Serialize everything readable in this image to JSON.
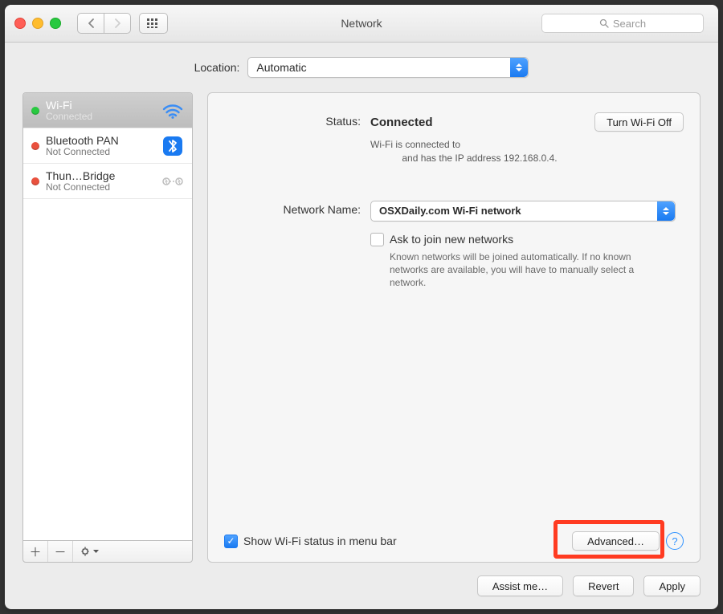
{
  "window": {
    "title": "Network",
    "search_placeholder": "Search"
  },
  "location": {
    "label": "Location:",
    "value": "Automatic"
  },
  "services": [
    {
      "name": "Wi-Fi",
      "status": "Connected",
      "dot": "green",
      "icon": "wifi",
      "selected": true
    },
    {
      "name": "Bluetooth PAN",
      "status": "Not Connected",
      "dot": "red",
      "icon": "bluetooth",
      "selected": false
    },
    {
      "name": "Thun…Bridge",
      "status": "Not Connected",
      "dot": "red",
      "icon": "thunderbolt",
      "selected": false
    }
  ],
  "status": {
    "label": "Status:",
    "value": "Connected",
    "toggle_button": "Turn Wi-Fi Off",
    "desc_line1": "Wi-Fi is connected to",
    "desc_line2": "and has the IP address 192.168.0.4."
  },
  "network_name": {
    "label": "Network Name:",
    "value": "OSXDaily.com Wi-Fi network"
  },
  "ask_join": {
    "checked": false,
    "label": "Ask to join new networks",
    "help": "Known networks will be joined automatically. If no known networks are available, you will have to manually select a network."
  },
  "menu_bar": {
    "checked": true,
    "label": "Show Wi-Fi status in menu bar"
  },
  "advanced_button": "Advanced…",
  "bottom_buttons": {
    "assist": "Assist me…",
    "revert": "Revert",
    "apply": "Apply"
  }
}
